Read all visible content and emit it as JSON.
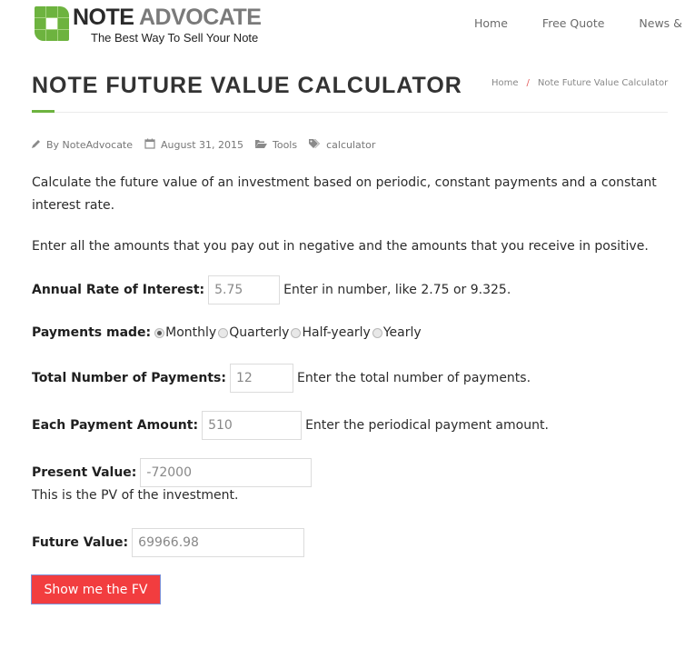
{
  "header": {
    "logo": {
      "title_part1": "NOTE",
      "title_part2": "ADVOCATE",
      "tagline": "The Best Way To Sell Your Note",
      "brand_color": "#6db33f"
    },
    "nav": [
      {
        "label": "Home"
      },
      {
        "label": "Free Quote"
      },
      {
        "label": "News & Re"
      }
    ]
  },
  "page": {
    "title": "NOTE FUTURE VALUE CALCULATOR",
    "breadcrumb": {
      "home": "Home",
      "separator": "/",
      "current": "Note Future Value Calculator"
    },
    "meta": {
      "author": "By NoteAdvocate",
      "author_icon": "pencil-icon",
      "date": "August 31, 2015",
      "date_icon": "calendar-icon",
      "category": "Tools",
      "category_icon": "folder-open-icon",
      "tag": "calculator",
      "tag_icon": "tags-icon"
    },
    "intro": "Calculate the future value of an investment based on periodic, constant payments and a constant interest rate.",
    "instructions": "Enter all the amounts that you pay out in negative and the amounts that you receive in positive."
  },
  "form": {
    "rate": {
      "label": "Annual Rate of Interest:",
      "value": "5.75",
      "hint": "Enter in number, like 2.75 or 9.325."
    },
    "payments_made": {
      "label": "Payments made:",
      "options": [
        {
          "label": "Monthly",
          "selected": true
        },
        {
          "label": "Quarterly",
          "selected": false
        },
        {
          "label": "Half-yearly",
          "selected": false
        },
        {
          "label": "Yearly",
          "selected": false
        }
      ]
    },
    "num_payments": {
      "label": "Total Number of Payments:",
      "value": "12",
      "hint": "Enter the total number of payments."
    },
    "payment_amount": {
      "label": "Each Payment Amount:",
      "value": "510",
      "hint": "Enter the periodical payment amount."
    },
    "present_value": {
      "label": "Present Value:",
      "value": "-72000",
      "hint": "This is the PV of the investment."
    },
    "future_value": {
      "label": "Future Value:",
      "value": "69966.98"
    },
    "submit_label": "Show me the FV",
    "submit_color": "#f23d3f"
  }
}
